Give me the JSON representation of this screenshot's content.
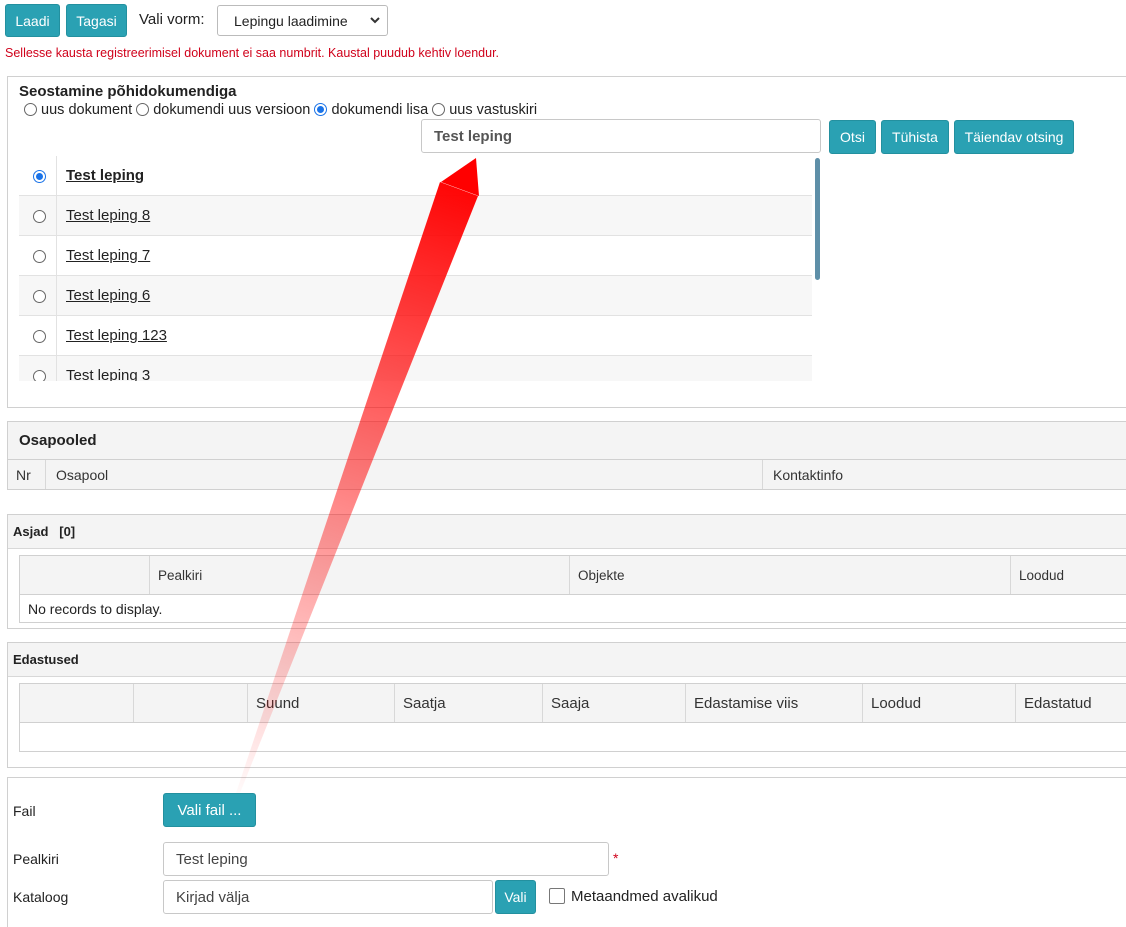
{
  "toolbar": {
    "load_label": "Laadi",
    "back_label": "Tagasi",
    "form_label": "Vali vorm:",
    "form_selected": "Lepingu laadimine"
  },
  "error_message": "Sellesse kausta registreerimisel dokument ei saa numbrit. Kaustal puudub kehtiv loendur.",
  "link_section": {
    "title": "Seostamine põhidokumendiga",
    "radio_options": [
      "uus dokument",
      "dokumendi uus versioon",
      "dokumendi lisa",
      "uus vastuskiri"
    ],
    "selected_option": "dokumendi lisa",
    "search_value": "Test leping",
    "search_button": "Otsi",
    "clear_button": "Tühista",
    "advanced_button": "Täiendav otsing",
    "results": [
      "Test leping",
      "Test leping 8",
      "Test leping 7",
      "Test leping 6",
      "Test leping 123",
      "Test leping 3"
    ],
    "selected_result": "Test leping"
  },
  "parties": {
    "title": "Osapooled",
    "columns": [
      "Nr",
      "Osapool",
      "Kontaktinfo"
    ]
  },
  "cases": {
    "title": "Asjad",
    "count": "[0]",
    "columns": [
      "",
      "Pealkiri",
      "Objekte",
      "Loodud"
    ],
    "empty_text": "No records to display."
  },
  "forwardings": {
    "title": "Edastused",
    "columns": [
      "",
      "",
      "Suund",
      "Saatja",
      "Saaja",
      "Edastamise viis",
      "Loodud",
      "Edastatud"
    ]
  },
  "form": {
    "file_label": "Fail",
    "file_button": "Vali fail ...",
    "title_label": "Pealkiri",
    "title_value": "Test leping",
    "required_mark": "*",
    "catalog_label": "Kataloog",
    "catalog_value": "Kirjad välja",
    "catalog_button": "Vali",
    "metadata_public_label": "Metaandmed avalikud"
  },
  "colors": {
    "accent": "#2aa1b3",
    "error": "#d0021b",
    "arrow": "#ff0000"
  }
}
